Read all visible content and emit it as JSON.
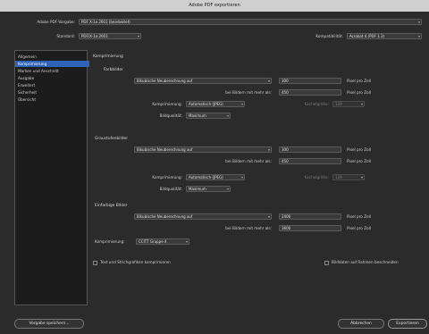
{
  "window": {
    "title": "Adobe PDF exportieren"
  },
  "preset": {
    "label": "Adobe PDF-Vorgabe:",
    "value": "PDF X-1a 2001 (bearbeitet)"
  },
  "standard": {
    "label": "Standard:",
    "value": "PDF/X-1a:2001"
  },
  "compat": {
    "label": "Kompatibilität:",
    "value": "Acrobat 4 (PDF 1.3)"
  },
  "sidebar": {
    "items": [
      {
        "label": "Allgemein"
      },
      {
        "label": "Komprimierung",
        "selected": true
      },
      {
        "label": "Marken und Anschnitt"
      },
      {
        "label": "Ausgabe"
      },
      {
        "label": "Erweitert"
      },
      {
        "label": "Sicherheit"
      },
      {
        "label": "Übersicht"
      }
    ]
  },
  "main": {
    "section_title": "Komprimierung",
    "groups": [
      {
        "title": "Farbbilder",
        "downsample_value": "Bikubische Neuberechnung auf",
        "dpi": "300",
        "dpi_unit": "Pixel pro Zoll",
        "threshold_label": "bei Bildern mit mehr als:",
        "threshold": "450",
        "threshold_unit": "Pixel pro Zoll",
        "compression_label": "Komprimierung:",
        "compression_value": "Automatisch (JPEG)",
        "tile_label": "Kachelgröße:",
        "tile_value": "128",
        "quality_label": "Bildqualität:",
        "quality_value": "Maximum"
      },
      {
        "title": "Graustufenbilder",
        "downsample_value": "Bikubische Neuberechnung auf",
        "dpi": "300",
        "dpi_unit": "Pixel pro Zoll",
        "threshold_label": "bei Bildern mit mehr als:",
        "threshold": "450",
        "threshold_unit": "Pixel pro Zoll",
        "compression_label": "Komprimierung:",
        "compression_value": "Automatisch (JPEG)",
        "tile_label": "Kachelgröße:",
        "tile_value": "128",
        "quality_label": "Bildqualität:",
        "quality_value": "Maximum"
      },
      {
        "title": "Einfarbige Bilder",
        "downsample_value": "Bikubische Neuberechnung auf",
        "dpi": "2400",
        "dpi_unit": "Pixel pro Zoll",
        "threshold_label": "bei Bildern mit mehr als:",
        "threshold": "3600",
        "threshold_unit": "Pixel pro Zoll",
        "compression_label": "Komprimierung:",
        "compression_value": "CCITT Gruppe 4"
      }
    ],
    "compress_text_label": "Text und Strichgrafiken komprimieren",
    "crop_label": "Bilddaten auf Rahmen beschneiden"
  },
  "buttons": {
    "save_preset": "Vorgabe speichern...",
    "cancel": "Abbrechen",
    "export": "Exportieren"
  }
}
